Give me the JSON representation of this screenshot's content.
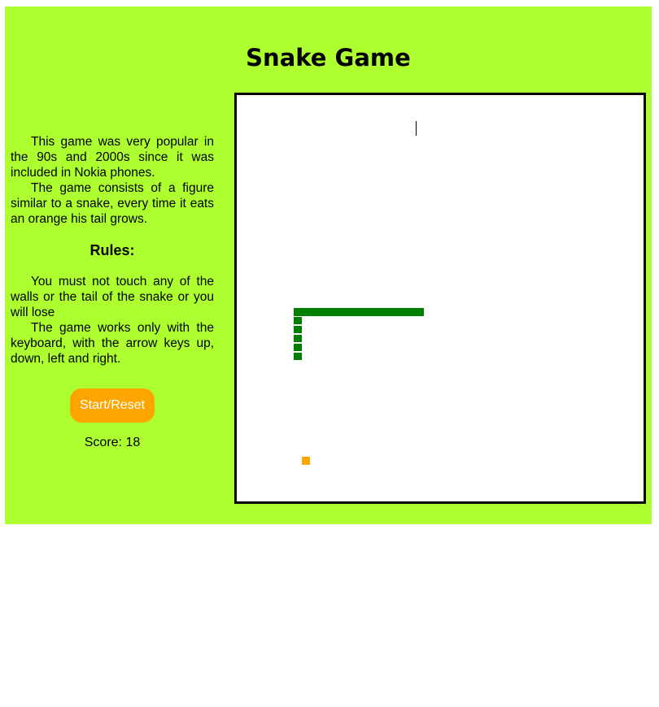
{
  "title": "Snake Game",
  "intro": {
    "paragraph1": "This game was very popular in the 90s and 2000s since it was included in Nokia phones.",
    "paragraph2": "The game consists of a figure similar to a snake, every time it eats an orange his tail grows."
  },
  "rules": {
    "heading": "Rules:",
    "paragraph1": "You must not touch any of the walls or the tail of the snake or you will lose",
    "paragraph2": "The game works only with the keyboard, with the arrow keys up, down, left and right."
  },
  "controls": {
    "start_reset_label": "Start/Reset"
  },
  "score": {
    "label": "Score: 18",
    "value": 18
  },
  "colors": {
    "page_background": "#adff2f",
    "snake": "#008000",
    "food": "#ffa500",
    "button": "#ffa500",
    "board": "#ffffff"
  }
}
